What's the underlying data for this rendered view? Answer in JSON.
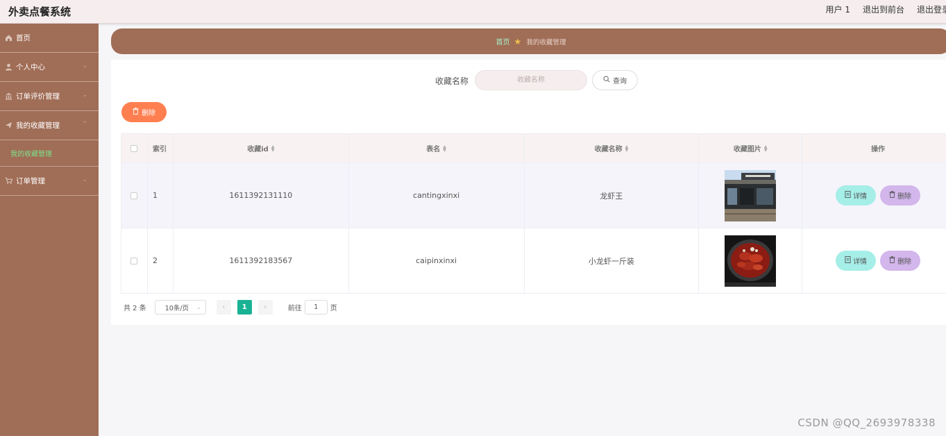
{
  "app": {
    "title": "外卖点餐系统",
    "user_label": "用户 1",
    "back_label": "退出到前台",
    "logout_label": "退出登录"
  },
  "sidebar": {
    "items": [
      {
        "label": "首页",
        "icon": "home-icon",
        "expandable": false
      },
      {
        "label": "个人中心",
        "icon": "user-icon",
        "expandable": true
      },
      {
        "label": "订单评价管理",
        "icon": "bank-icon",
        "expandable": true
      },
      {
        "label": "我的收藏管理",
        "icon": "send-icon",
        "expandable": true,
        "expanded": true
      },
      {
        "label": "订单管理",
        "icon": "cart-icon",
        "expandable": true
      }
    ],
    "submenu_label": "我的收藏管理"
  },
  "breadcrumb": {
    "home": "首页",
    "current": "我的收藏管理"
  },
  "search": {
    "label": "收藏名称",
    "placeholder": "收藏名称",
    "button_label": "查询"
  },
  "toolbar": {
    "delete_label": "删除"
  },
  "table": {
    "columns": [
      "索引",
      "收藏id",
      "表名",
      "收藏名称",
      "收藏图片",
      "操作"
    ],
    "rows": [
      {
        "index": "1",
        "id": "1611392131110",
        "table_name": "cantingxinxi",
        "name": "龙虾王",
        "image": "restaurant-storefront-photo"
      },
      {
        "index": "2",
        "id": "1611392183567",
        "table_name": "caipinxinxi",
        "name": "小龙虾一斤装",
        "image": "crayfish-plate-photo"
      }
    ],
    "detail_label": "详情",
    "delete_label": "删除"
  },
  "pagination": {
    "total_text": "共 2 条",
    "page_size": "10条/页",
    "current_page": "1",
    "goto_label": "前往",
    "goto_value": "1",
    "page_suffix": "页"
  },
  "watermark": "CSDN @QQ_2693978338",
  "colors": {
    "sidebar": "#a06d56",
    "accent_orange": "#ff7f50",
    "detail_btn": "#a6eee8",
    "delete_btn": "#d3b6ec",
    "page_active": "#19b394"
  }
}
